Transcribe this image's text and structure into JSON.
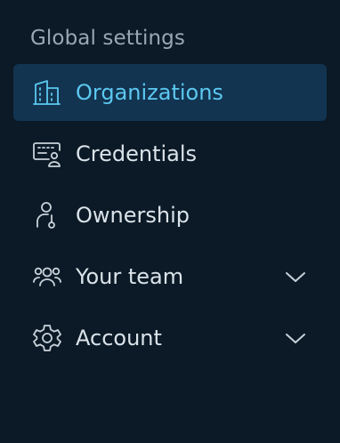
{
  "sidebar": {
    "section_title": "Global settings",
    "items": [
      {
        "label": "Organizations",
        "icon": "building-icon",
        "active": true,
        "expandable": false
      },
      {
        "label": "Credentials",
        "icon": "credentials-icon",
        "active": false,
        "expandable": false
      },
      {
        "label": "Ownership",
        "icon": "ownership-icon",
        "active": false,
        "expandable": false
      },
      {
        "label": "Your team",
        "icon": "team-icon",
        "active": false,
        "expandable": true
      },
      {
        "label": "Account",
        "icon": "gear-icon",
        "active": false,
        "expandable": true
      }
    ]
  },
  "colors": {
    "background": "#0b1a26",
    "active_background": "#123451",
    "accent": "#5cc8f0",
    "text": "#dbe3ea",
    "muted": "#9aa7b2"
  }
}
